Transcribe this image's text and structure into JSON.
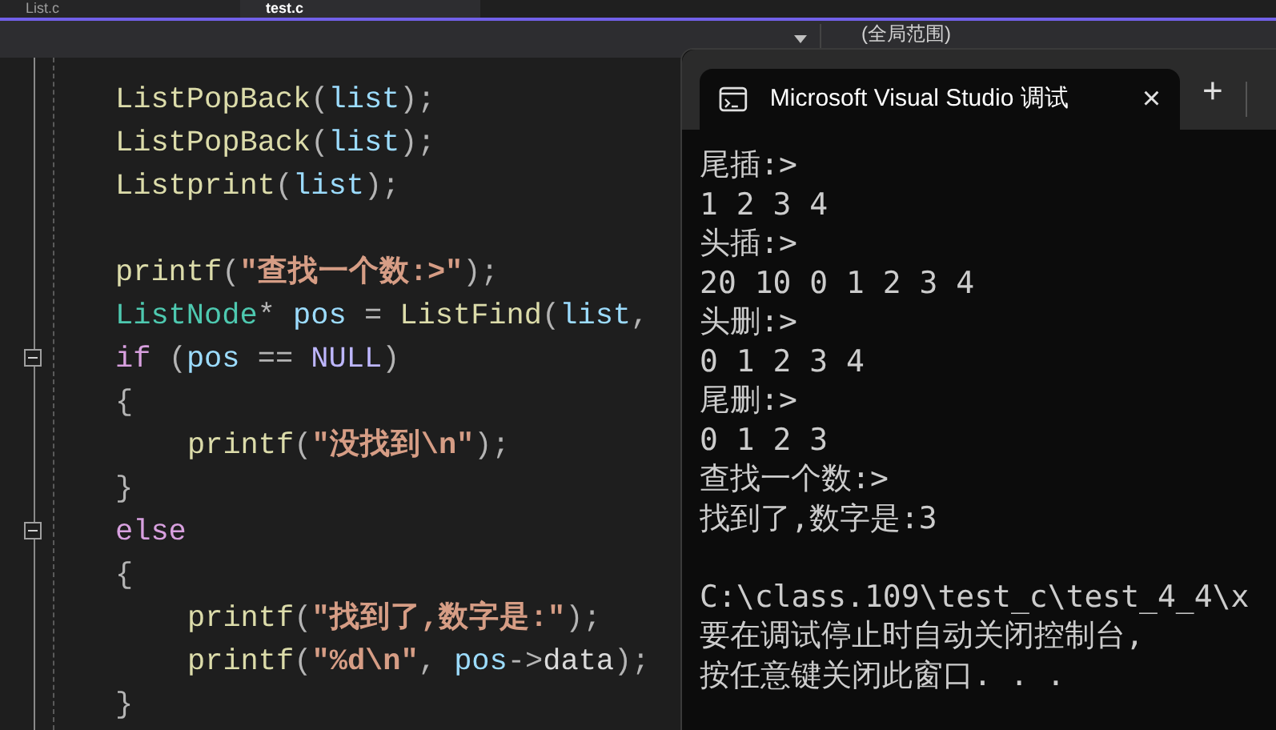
{
  "editor_tabs": [
    {
      "label": "List.c",
      "selected": false
    },
    {
      "label": "test.c",
      "selected": true
    }
  ],
  "nav_bar": {
    "scope": "(全局范围)"
  },
  "code": {
    "lines": [
      {
        "kind": "code",
        "indented": false,
        "fold": false,
        "tokens": [
          {
            "kind": "fn",
            "text": "ListPopBack"
          },
          {
            "kind": "punct",
            "text": "("
          },
          {
            "kind": "param",
            "text": "list"
          },
          {
            "kind": "punct",
            "text": ");"
          }
        ]
      },
      {
        "kind": "code",
        "indented": false,
        "fold": false,
        "tokens": [
          {
            "kind": "fn",
            "text": "ListPopBack"
          },
          {
            "kind": "punct",
            "text": "("
          },
          {
            "kind": "param",
            "text": "list"
          },
          {
            "kind": "punct",
            "text": ");"
          }
        ]
      },
      {
        "kind": "code",
        "indented": false,
        "fold": false,
        "tokens": [
          {
            "kind": "fn",
            "text": "Listprint"
          },
          {
            "kind": "punct",
            "text": "("
          },
          {
            "kind": "param",
            "text": "list"
          },
          {
            "kind": "punct",
            "text": ");"
          }
        ]
      },
      {
        "kind": "blank",
        "fold": false
      },
      {
        "kind": "code",
        "indented": false,
        "fold": false,
        "tokens": [
          {
            "kind": "fn",
            "text": "printf"
          },
          {
            "kind": "punct",
            "text": "("
          },
          {
            "kind": "str",
            "text": "\"查找一个数:>\""
          },
          {
            "kind": "punct",
            "text": ");"
          }
        ]
      },
      {
        "kind": "code",
        "indented": false,
        "fold": false,
        "tokens": [
          {
            "kind": "type",
            "text": "ListNode"
          },
          {
            "kind": "punct",
            "text": "* "
          },
          {
            "kind": "param",
            "text": "pos"
          },
          {
            "kind": "punct",
            "text": " = "
          },
          {
            "kind": "fn",
            "text": "ListFind"
          },
          {
            "kind": "punct",
            "text": "("
          },
          {
            "kind": "param",
            "text": "list"
          },
          {
            "kind": "punct",
            "text": ","
          }
        ]
      },
      {
        "kind": "code",
        "indented": false,
        "fold": true,
        "tokens": [
          {
            "kind": "kw",
            "text": "if"
          },
          {
            "kind": "punct",
            "text": " ("
          },
          {
            "kind": "param",
            "text": "pos"
          },
          {
            "kind": "punct",
            "text": " == "
          },
          {
            "kind": "macro",
            "text": "NULL"
          },
          {
            "kind": "punct",
            "text": ")"
          }
        ]
      },
      {
        "kind": "code",
        "indented": false,
        "fold": false,
        "tokens": [
          {
            "kind": "punct",
            "text": "{"
          }
        ]
      },
      {
        "kind": "code",
        "indented": true,
        "fold": false,
        "tokens": [
          {
            "kind": "fn",
            "text": "printf"
          },
          {
            "kind": "punct",
            "text": "("
          },
          {
            "kind": "str",
            "text": "\"没找到\\n\""
          },
          {
            "kind": "punct",
            "text": ");"
          }
        ]
      },
      {
        "kind": "code",
        "indented": false,
        "fold": false,
        "tokens": [
          {
            "kind": "punct",
            "text": "}"
          }
        ]
      },
      {
        "kind": "code",
        "indented": false,
        "fold": true,
        "tokens": [
          {
            "kind": "kw",
            "text": "else"
          }
        ]
      },
      {
        "kind": "code",
        "indented": false,
        "fold": false,
        "tokens": [
          {
            "kind": "punct",
            "text": "{"
          }
        ]
      },
      {
        "kind": "code",
        "indented": true,
        "fold": false,
        "tokens": [
          {
            "kind": "fn",
            "text": "printf"
          },
          {
            "kind": "punct",
            "text": "("
          },
          {
            "kind": "str",
            "text": "\"找到了,数字是:\""
          },
          {
            "kind": "punct",
            "text": ");"
          }
        ]
      },
      {
        "kind": "code",
        "indented": true,
        "fold": false,
        "tokens": [
          {
            "kind": "fn",
            "text": "printf"
          },
          {
            "kind": "punct",
            "text": "("
          },
          {
            "kind": "str",
            "text": "\"%d\\n\""
          },
          {
            "kind": "punct",
            "text": ", "
          },
          {
            "kind": "param",
            "text": "pos"
          },
          {
            "kind": "punct",
            "text": "->"
          },
          {
            "kind": "member",
            "text": "data"
          },
          {
            "kind": "punct",
            "text": ");"
          }
        ]
      },
      {
        "kind": "code",
        "indented": false,
        "fold": false,
        "tokens": [
          {
            "kind": "punct",
            "text": "}"
          }
        ]
      }
    ]
  },
  "console": {
    "tab_title": "Microsoft Visual Studio 调试",
    "close": "×",
    "new_tab": "+",
    "output_lines": [
      "尾插:>",
      "1 2 3 4",
      "头插:>",
      "20 10 0 1 2 3 4",
      "头删:>",
      "0 1 2 3 4",
      "尾删:>",
      "0 1 2 3",
      "查找一个数:>",
      "找到了,数字是:3"
    ],
    "exit_lines": [
      "C:\\class.109\\test_c\\test_4_4\\x",
      "要在调试停止时自动关闭控制台,",
      "按任意键关闭此窗口. . ."
    ]
  }
}
